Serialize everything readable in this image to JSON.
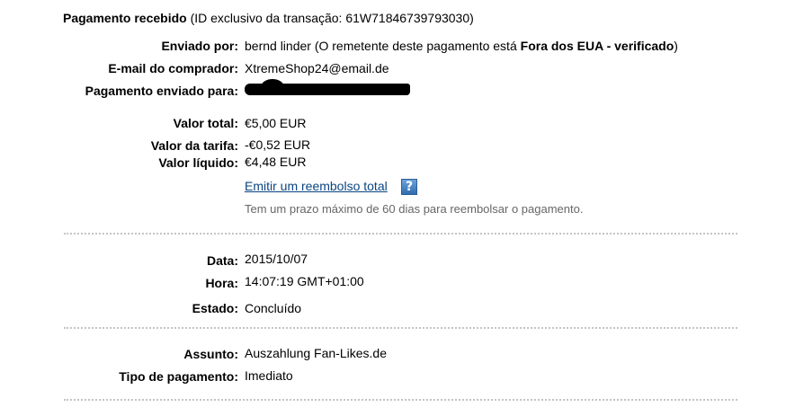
{
  "header": {
    "title": "Pagamento recebido",
    "transaction_text": "(ID exclusivo da transação: 61W71846739793030)"
  },
  "sender": {
    "label": "Enviado por:",
    "name": "bernd linder",
    "status_prefix": "(O remetente deste pagamento está",
    "status_bold": "Fora dos EUA - verificado",
    "status_suffix": ")"
  },
  "buyer_email": {
    "label": "E-mail do comprador:",
    "value": "XtremeShop24@email.de"
  },
  "payment_sent_to": {
    "label": "Pagamento enviado para:"
  },
  "amounts": {
    "total_label": "Valor total:",
    "total_value": "€5,00 EUR",
    "fee_label": "Valor da tarifa:",
    "fee_value": "-€0,52 EUR",
    "net_label": "Valor líquido:",
    "net_value": "€4,48 EUR"
  },
  "refund": {
    "link_label": "Emitir um reembolso total",
    "help_icon": "?",
    "note": "Tem um prazo máximo de 60 dias para reembolsar o pagamento."
  },
  "details": {
    "date_label": "Data:",
    "date_value": "2015/10/07",
    "time_label": "Hora:",
    "time_value": "14:07:19 GMT+01:00",
    "status_label": "Estado:",
    "status_value": "Concluído"
  },
  "subject": {
    "label": "Assunto:",
    "value": "Auszahlung Fan-Likes.de"
  },
  "payment_type": {
    "label": "Tipo de pagamento:",
    "value": "Imediato"
  },
  "colors": {
    "link": "#084482",
    "help_icon": "#3a78bd",
    "note_text": "#666666",
    "divider": "#c4c4c4"
  }
}
